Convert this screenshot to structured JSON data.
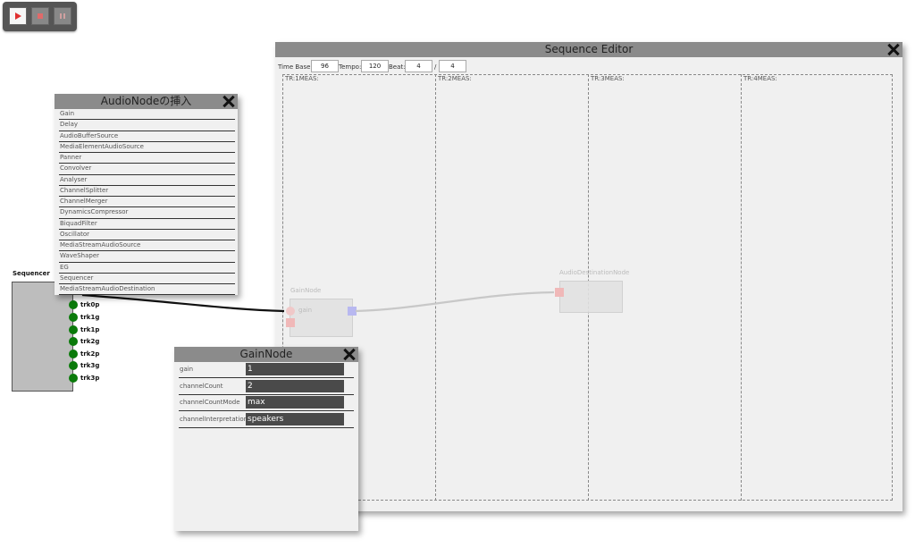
{
  "toolbar": {
    "buttons": [
      {
        "name": "play-icon",
        "active": true
      },
      {
        "name": "stop-icon",
        "active": false
      },
      {
        "name": "pause-icon",
        "active": false
      }
    ],
    "colors": {
      "play": "#e03030",
      "panel": "#555555"
    }
  },
  "sequence_editor": {
    "title": "Sequence Editor",
    "time_base_label": "Time Base:",
    "time_base_value": "96",
    "tempo_label": "Tempo:",
    "tempo_value": "120",
    "beat_label": "Beat:",
    "beat_numerator": "4",
    "beat_separator": "/",
    "beat_denominator": "4",
    "measures": [
      "TR:1MEAS:",
      "TR:2MEAS:",
      "TR:3MEAS:",
      "TR:4MEAS:"
    ],
    "ghost_nodes": {
      "gain_title": "GainNode",
      "gain_port": "gain",
      "destination_title": "AudioDestinationNode"
    }
  },
  "insert_menu": {
    "title": "AudioNodeの挿入",
    "items": [
      "Gain",
      "Delay",
      "AudioBufferSource",
      "MediaElementAudioSource",
      "Panner",
      "Convolver",
      "Analyser",
      "ChannelSplitter",
      "ChannelMerger",
      "DynamicsCompressor",
      "BiquadFilter",
      "Oscillator",
      "MediaStreamAudioSource",
      "WaveShaper",
      "EG",
      "Sequencer",
      "MediaStreamAudioDestination"
    ]
  },
  "sequencer": {
    "label": "Sequencer",
    "tracks": [
      "trk0p",
      "trk1g",
      "trk1p",
      "trk2g",
      "trk2p",
      "trk3g",
      "trk3p"
    ]
  },
  "gain_panel": {
    "title": "GainNode",
    "properties": [
      {
        "label": "gain",
        "value": "1"
      },
      {
        "label": "channelCount",
        "value": "2"
      },
      {
        "label": "channelCountMode",
        "value": "max"
      },
      {
        "label": "channelInterpretation",
        "value": "speakers"
      }
    ]
  }
}
